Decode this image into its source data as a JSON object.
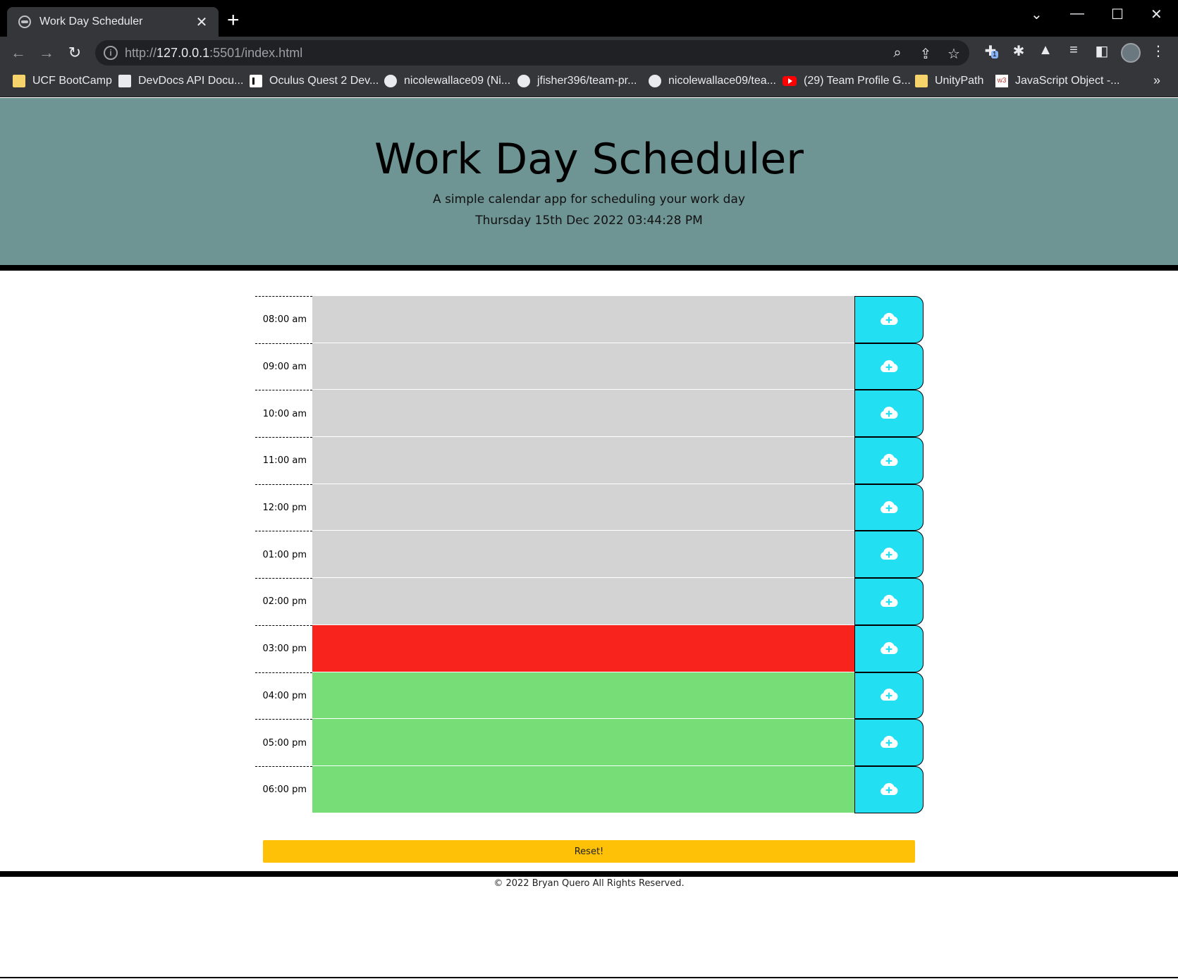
{
  "browser": {
    "tab_title": "Work Day Scheduler",
    "url_scheme": "http://",
    "url_host": "127.0.0.1",
    "url_rest": ":5501/index.html",
    "extension_badge": "1",
    "bookmarks": [
      {
        "label": "UCF BootCamp",
        "icon": "folder-icon"
      },
      {
        "label": "DevDocs API Docu...",
        "icon": "devdocs-icon"
      },
      {
        "label": "Oculus Quest 2 Dev...",
        "icon": "patreon-icon"
      },
      {
        "label": "nicolewallace09 (Ni...",
        "icon": "github-icon"
      },
      {
        "label": "jfisher396/team-pr...",
        "icon": "github-icon"
      },
      {
        "label": "nicolewallace09/tea...",
        "icon": "github-icon"
      },
      {
        "label": "(29) Team Profile G...",
        "icon": "youtube-icon"
      },
      {
        "label": "UnityPath",
        "icon": "folder-icon"
      },
      {
        "label": "JavaScript Object -...",
        "icon": "w3schools-icon"
      }
    ]
  },
  "header": {
    "title": "Work Day Scheduler",
    "lead": "A simple calendar app for scheduling your work day",
    "current_date": "Thursday 15th Dec 2022 03:44:28 PM"
  },
  "colors": {
    "jumbotron": "#6e9494",
    "past": "#d3d3d3",
    "present": "#f7231c",
    "future": "#77dd77",
    "save_button": "#22e0f2",
    "reset_button": "#ffc107"
  },
  "timeblocks": [
    {
      "hour": "08:00 am",
      "state": "past",
      "text": ""
    },
    {
      "hour": "09:00 am",
      "state": "past",
      "text": ""
    },
    {
      "hour": "10:00 am",
      "state": "past",
      "text": ""
    },
    {
      "hour": "11:00 am",
      "state": "past",
      "text": ""
    },
    {
      "hour": "12:00 pm",
      "state": "past",
      "text": ""
    },
    {
      "hour": "01:00 pm",
      "state": "past",
      "text": ""
    },
    {
      "hour": "02:00 pm",
      "state": "past",
      "text": ""
    },
    {
      "hour": "03:00 pm",
      "state": "present",
      "text": ""
    },
    {
      "hour": "04:00 pm",
      "state": "future",
      "text": ""
    },
    {
      "hour": "05:00 pm",
      "state": "future",
      "text": ""
    },
    {
      "hour": "06:00 pm",
      "state": "future",
      "text": ""
    }
  ],
  "reset_label": "Reset!",
  "footer": "© 2022 Bryan Quero All Rights Reserved."
}
